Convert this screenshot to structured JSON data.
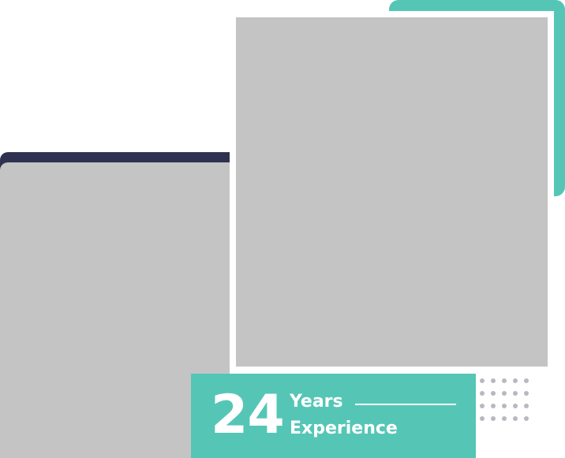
{
  "badge": {
    "number": "24",
    "line1": "Years",
    "line2": "Experience"
  },
  "colors": {
    "teal_accent": "#55c6b6",
    "navy_accent": "#2f3150",
    "placeholder_gray": "#c4c4c4",
    "dot_gray": "#b8b8c2"
  },
  "decorations": {
    "dot_grid_count": 20
  }
}
